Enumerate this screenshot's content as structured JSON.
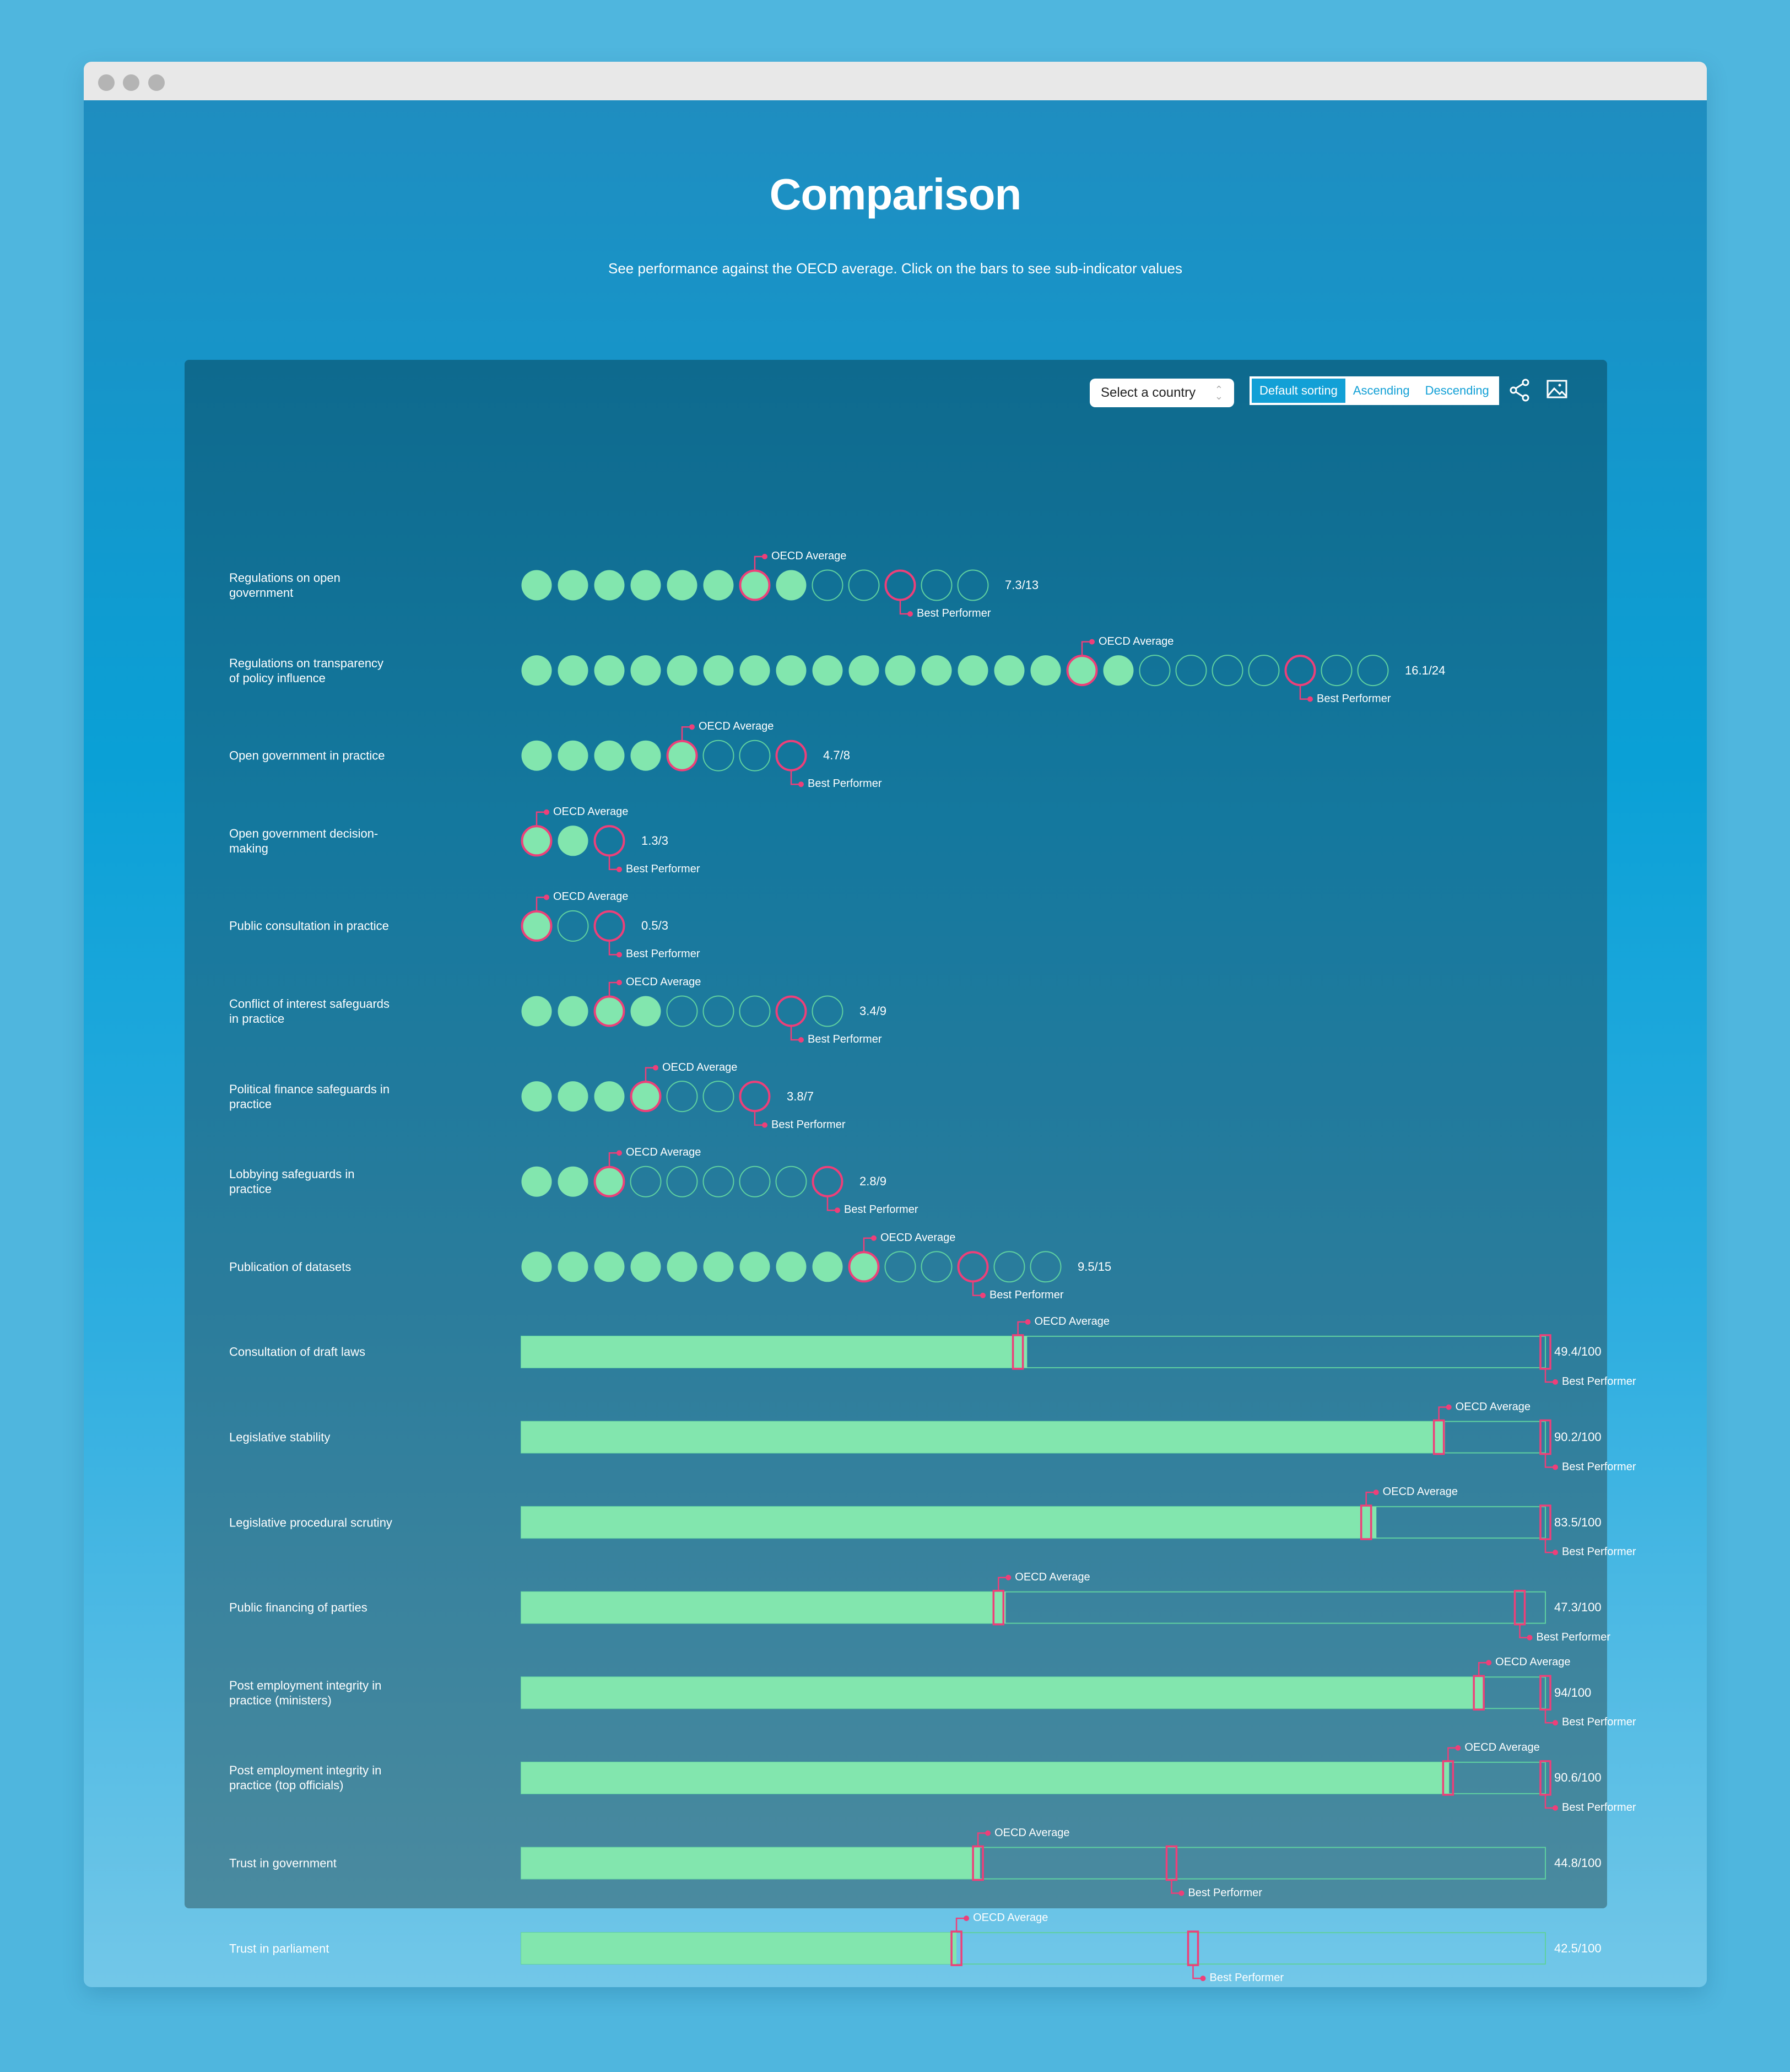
{
  "window": {
    "controls": [
      "close",
      "minimize",
      "maximize"
    ]
  },
  "header": {
    "title": "Comparison",
    "subtitle": "See performance against the OECD average. Click on the bars to see sub-indicator values"
  },
  "toolbar": {
    "country_select": {
      "value": "Select a country",
      "icon": "chevron-updown-icon"
    },
    "sorting": [
      {
        "label": "Default sorting",
        "active": true
      },
      {
        "label": "Ascending",
        "active": false
      },
      {
        "label": "Descending",
        "active": false
      }
    ],
    "share_icon": "share-icon",
    "image_icon": "image-download-icon"
  },
  "labels": {
    "oecd": "OECD Average",
    "best": "Best Performer"
  },
  "colors": {
    "fill": "#82e6ae",
    "outline": "#5fd0a0",
    "marker": "#ee3f79",
    "text": "#ffffff"
  },
  "chart_data": {
    "type": "dot-and-bullet-bar comparison",
    "title": "Comparison",
    "legend": [
      "OECD Average",
      "Best Performer"
    ],
    "rows": [
      {
        "label": "Regulations on open government",
        "kind": "dots",
        "value": 7.3,
        "max": 13,
        "score": "7.3/13",
        "oecd_dot": 7,
        "best_dot": 11,
        "filled": 8
      },
      {
        "label": "Regulations on transparency of policy influence",
        "kind": "dots",
        "value": 16.1,
        "max": 24,
        "score": "16.1/24",
        "oecd_dot": 16,
        "best_dot": 22,
        "filled": 17
      },
      {
        "label": "Open government in practice",
        "kind": "dots",
        "value": 4.7,
        "max": 8,
        "score": "4.7/8",
        "oecd_dot": 5,
        "best_dot": 8,
        "filled": 5
      },
      {
        "label": "Open government decision-making",
        "kind": "dots",
        "value": 1.3,
        "max": 3,
        "score": "1.3/3",
        "oecd_dot": 1,
        "best_dot": 3,
        "filled": 2
      },
      {
        "label": "Public consultation in practice",
        "kind": "dots",
        "value": 0.5,
        "max": 3,
        "score": "0.5/3",
        "oecd_dot": 1,
        "best_dot": 3,
        "filled": 1
      },
      {
        "label": "Conflict of interest safeguards in practice",
        "kind": "dots",
        "value": 3.4,
        "max": 9,
        "score": "3.4/9",
        "oecd_dot": 3,
        "best_dot": 8,
        "filled": 4
      },
      {
        "label": "Political finance safeguards in practice",
        "kind": "dots",
        "value": 3.8,
        "max": 7,
        "score": "3.8/7",
        "oecd_dot": 4,
        "best_dot": 7,
        "filled": 4
      },
      {
        "label": "Lobbying safeguards in practice",
        "kind": "dots",
        "value": 2.8,
        "max": 9,
        "score": "2.8/9",
        "oecd_dot": 3,
        "best_dot": 9,
        "filled": 3
      },
      {
        "label": "Publication of datasets",
        "kind": "dots",
        "value": 9.5,
        "max": 15,
        "score": "9.5/15",
        "oecd_dot": 10,
        "best_dot": 13,
        "filled": 10
      },
      {
        "label": "Consultation of draft laws",
        "kind": "bar",
        "value": 49.4,
        "max": 100,
        "score": "49.4/100",
        "oecd": 48.5,
        "best": 100
      },
      {
        "label": "Legislative stability",
        "kind": "bar",
        "value": 90.2,
        "max": 100,
        "score": "90.2/100",
        "oecd": 89.6,
        "best": 100
      },
      {
        "label": "Legislative procedural scrutiny",
        "kind": "bar",
        "value": 83.5,
        "max": 100,
        "score": "83.5/100",
        "oecd": 82.5,
        "best": 100
      },
      {
        "label": "Public financing of parties",
        "kind": "bar",
        "value": 47.3,
        "max": 100,
        "score": "47.3/100",
        "oecd": 46.6,
        "best": 97.5
      },
      {
        "label": "Post employment integrity in practice (ministers)",
        "kind": "bar",
        "value": 94,
        "max": 100,
        "score": "94/100",
        "oecd": 93.5,
        "best": 100
      },
      {
        "label": "Post employment integrity in practice (top officials)",
        "kind": "bar",
        "value": 90.6,
        "max": 100,
        "score": "90.6/100",
        "oecd": 90.5,
        "best": 100
      },
      {
        "label": "Trust in government",
        "kind": "bar",
        "value": 44.8,
        "max": 100,
        "score": "44.8/100",
        "oecd": 44.6,
        "best": 63.5
      },
      {
        "label": "Trust in parliament",
        "kind": "bar",
        "value": 42.5,
        "max": 100,
        "score": "42.5/100",
        "oecd": 42.5,
        "best": 65.6
      }
    ]
  }
}
